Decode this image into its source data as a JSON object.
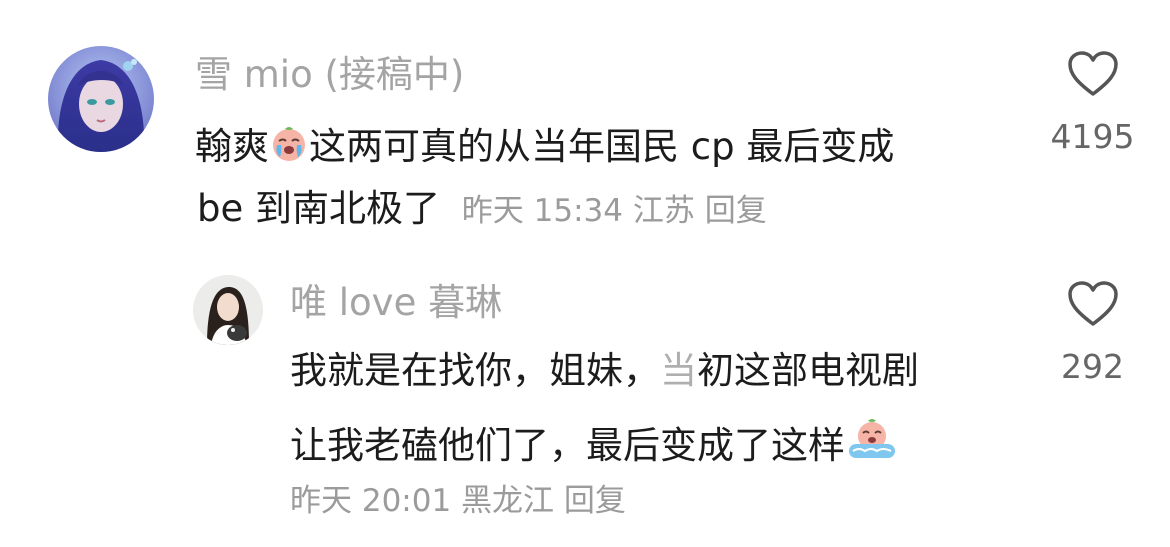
{
  "comments": [
    {
      "username": "雪 mio (接稿中)",
      "text_line1_a": "翰爽",
      "text_line1_b": "这两可真的从当年国民 cp 最后变成",
      "text_line2": "be 到南北极了",
      "time": "昨天 15:34",
      "location": "江苏",
      "reply_label": "回复",
      "like_count": "4195",
      "emoji": "crying-peach-emoji"
    },
    {
      "username": "唯 love 暮琳",
      "text_line1_a": "我就是在找你，姐妹，",
      "text_line1_censored": "当",
      "text_line1_b": "初这部电视剧",
      "text_line2": "让我老磕他们了，最后变成了这样",
      "time": "昨天 20:01",
      "location": "黑龙江",
      "reply_label": "回复",
      "like_count": "292",
      "emoji": "crying-peach-bath-emoji"
    }
  ],
  "colors": {
    "username": "#a4a4a4",
    "text": "#1c1c1c",
    "meta": "#9b9b9b",
    "like_icon": "#555555"
  }
}
